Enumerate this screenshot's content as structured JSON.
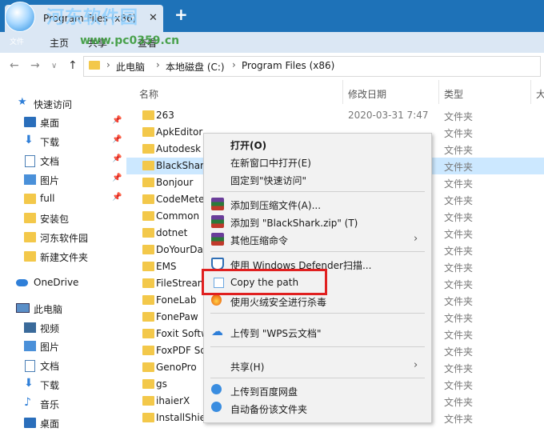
{
  "window": {
    "tab_title": "Program Files (x86)",
    "tab_close": "✕",
    "new_tab": "+",
    "watermark_title": "河东软件园",
    "watermark_logo_text": "文件",
    "watermark_url": "www.pc0359.cn"
  },
  "ribbon": {
    "items": [
      "主页",
      "共享",
      "查看"
    ]
  },
  "nav": {
    "back": "←",
    "forward": "→",
    "recent": "∨",
    "up": "↑"
  },
  "address": {
    "crumbs": [
      "此电脑",
      "本地磁盘 (C:)",
      "Program Files (x86)"
    ],
    "sep": "›"
  },
  "sidebar": {
    "items": [
      {
        "label": "快速访问",
        "pinned": false
      },
      {
        "label": "桌面",
        "pinned": true
      },
      {
        "label": "下载",
        "pinned": true
      },
      {
        "label": "文档",
        "pinned": true
      },
      {
        "label": "图片",
        "pinned": true
      },
      {
        "label": "full",
        "pinned": true
      },
      {
        "label": "安装包",
        "pinned": false
      },
      {
        "label": "河东软件园",
        "pinned": false
      },
      {
        "label": "新建文件夹",
        "pinned": false
      },
      {
        "label": "OneDrive",
        "pinned": false
      },
      {
        "label": "此电脑",
        "pinned": false
      },
      {
        "label": "视频",
        "pinned": false
      },
      {
        "label": "图片",
        "pinned": false
      },
      {
        "label": "文档",
        "pinned": false
      },
      {
        "label": "下载",
        "pinned": false
      },
      {
        "label": "音乐",
        "pinned": false
      },
      {
        "label": "桌面",
        "pinned": false
      }
    ],
    "pin_glyph": "📌"
  },
  "columns": {
    "name": "名称",
    "date": "修改日期",
    "type": "类型",
    "size": "大"
  },
  "files": [
    {
      "name": "263",
      "date": "2020-03-31 7:47",
      "type": "文件夹"
    },
    {
      "name": "ApkEditor",
      "date": "",
      "type": "文件夹"
    },
    {
      "name": "Autodesk",
      "date": "",
      "type": "文件夹"
    },
    {
      "name": "BlackShark",
      "date": "",
      "type": "文件夹",
      "selected": true
    },
    {
      "name": "Bonjour",
      "date": "",
      "type": "文件夹"
    },
    {
      "name": "CodeMeter",
      "date": "",
      "type": "文件夹"
    },
    {
      "name": "Common",
      "date": "",
      "type": "文件夹"
    },
    {
      "name": "dotnet",
      "date": "",
      "type": "文件夹"
    },
    {
      "name": "DoYourData",
      "date": "",
      "type": "文件夹"
    },
    {
      "name": "EMS",
      "date": "",
      "type": "文件夹"
    },
    {
      "name": "FileStream",
      "date": "",
      "type": "文件夹"
    },
    {
      "name": "FoneLab",
      "date": "",
      "type": "文件夹"
    },
    {
      "name": "FonePaw",
      "date": "",
      "type": "文件夹"
    },
    {
      "name": "Foxit Software",
      "date": "",
      "type": "文件夹"
    },
    {
      "name": "FoxPDF Software",
      "date": "",
      "type": "文件夹"
    },
    {
      "name": "GenoPro",
      "date": "",
      "type": "文件夹"
    },
    {
      "name": "gs",
      "date": "",
      "type": "文件夹"
    },
    {
      "name": "ihaierX",
      "date": "",
      "type": "文件夹"
    },
    {
      "name": "InstallShield",
      "date": "",
      "type": "文件夹"
    }
  ],
  "context_menu": {
    "items": [
      {
        "label": "打开(O)",
        "icon": "",
        "bold": true
      },
      {
        "label": "在新窗口中打开(E)",
        "icon": ""
      },
      {
        "label": "固定到\"快速访问\"",
        "icon": ""
      },
      {
        "label": "添加到压缩文件(A)...",
        "icon": "winrar-icon"
      },
      {
        "label": "添加到 \"BlackShark.zip\" (T)",
        "icon": "winrar-icon"
      },
      {
        "label": "其他压缩命令",
        "icon": "winrar-icon",
        "submenu": true
      },
      {
        "label": "使用 Windows Defender扫描...",
        "icon": "defender-shield-icon"
      },
      {
        "label": "Copy the path",
        "icon": "copy-icon"
      },
      {
        "label": "使用火绒安全进行杀毒",
        "icon": "huorong-icon"
      },
      {
        "label": "上传到 \"WPS云文档\"",
        "icon": "upload-cloud-icon"
      },
      {
        "label": "共享(H)",
        "icon": "",
        "submenu": true
      },
      {
        "label": "上传到百度网盘",
        "icon": "baidu-icon"
      },
      {
        "label": "自动备份该文件夹",
        "icon": "baidu-icon"
      }
    ],
    "submenu_arrow": "›"
  },
  "colors": {
    "titlebar": "#1e72b8",
    "ribbon": "#dbe7f4",
    "selection": "#cce8ff",
    "highlight": "#e02020"
  }
}
